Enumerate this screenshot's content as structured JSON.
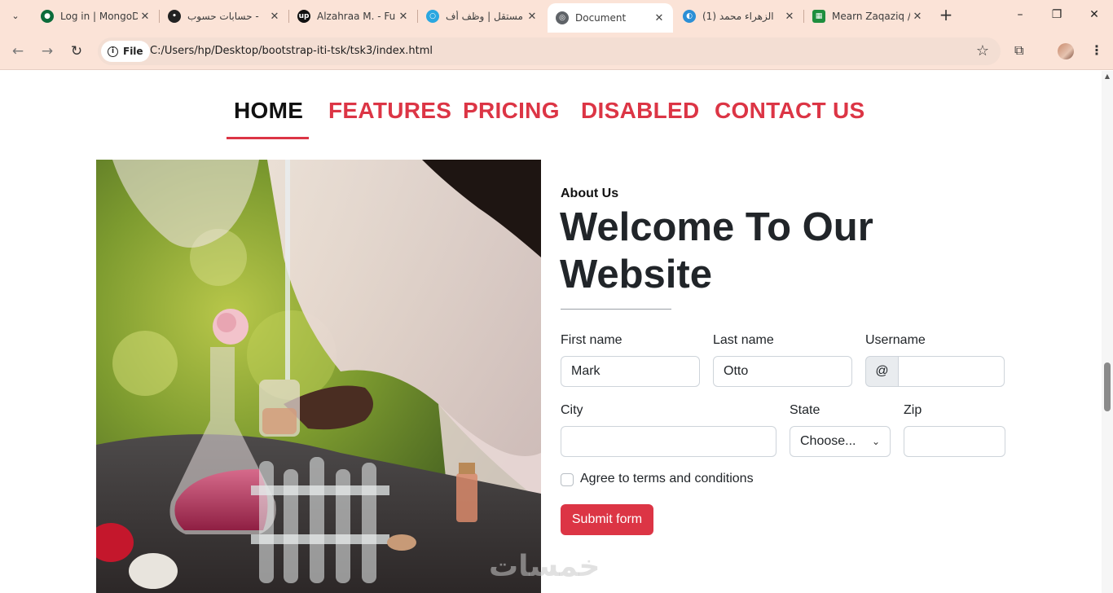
{
  "browser": {
    "tabs": [
      {
        "title": "Log in | MongoD",
        "icon": "mongodb-leaf-icon",
        "color": "#0b6b3a"
      },
      {
        "title": "حسابات حسوب -",
        "icon": "hsoub-icon",
        "color": "#222222"
      },
      {
        "title": "Alzahraa M. - Fu",
        "icon": "upwork-icon",
        "color": "#111111"
      },
      {
        "title": "مستقل | وظف أف",
        "icon": "mostaql-icon",
        "color": "#2aa7e0"
      },
      {
        "title": "Document",
        "icon": "globe-icon",
        "color": "#5f6368"
      },
      {
        "title": "(1) الزهراء محمد",
        "icon": "khamsat-icon",
        "color": "#2b8fd6"
      },
      {
        "title": "Mearn Zaqaziq /",
        "icon": "sheets-icon",
        "color": "#1e8e3e"
      }
    ],
    "address_chip": "File",
    "url": "C:/Users/hp/Desktop/bootstrap-iti-tsk/tsk3/index.html"
  },
  "nav": {
    "items": [
      "HOME",
      "FEATURES",
      "PRICING",
      "DISABLED",
      "CONTACT US"
    ],
    "active_color": "#111111",
    "link_color": "#dc3545"
  },
  "about": {
    "eyebrow": "About Us",
    "heading_line1": "Welcome To Our",
    "heading_line2": "Website"
  },
  "form": {
    "first_name": {
      "label": "First name",
      "value": "Mark"
    },
    "last_name": {
      "label": "Last name",
      "value": "Otto"
    },
    "username": {
      "label": "Username",
      "prefix": "@",
      "value": ""
    },
    "city": {
      "label": "City",
      "value": ""
    },
    "state": {
      "label": "State",
      "selected": "Choose..."
    },
    "zip": {
      "label": "Zip",
      "value": ""
    },
    "agree_label": "Agree to terms and conditions",
    "submit_label": "Submit form",
    "accent": "#dc3545"
  },
  "watermark": "خمسات"
}
